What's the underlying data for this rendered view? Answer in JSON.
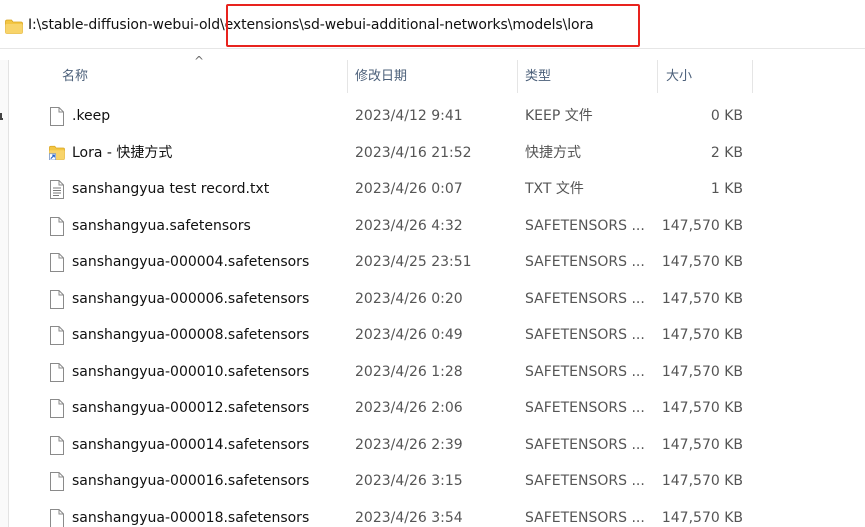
{
  "address_bar": {
    "path": "I:\\stable-diffusion-webui-old\\extensions\\sd-webui-additional-networks\\models\\lora",
    "folder_icon": "folder-icon"
  },
  "columns": {
    "name": "名称",
    "date": "修改日期",
    "type": "类型",
    "size": "大小"
  },
  "files": [
    {
      "name": ".keep",
      "date": "2023/4/12 9:41",
      "type": "KEEP 文件",
      "size": "0 KB",
      "icon": "blank-file-icon"
    },
    {
      "name": "Lora - 快捷方式",
      "date": "2023/4/16 21:52",
      "type": "快捷方式",
      "size": "2 KB",
      "icon": "folder-shortcut-icon"
    },
    {
      "name": "sanshangyua test record.txt",
      "date": "2023/4/26 0:07",
      "type": "TXT 文件",
      "size": "1 KB",
      "icon": "text-file-icon"
    },
    {
      "name": "sanshangyua.safetensors",
      "date": "2023/4/26 4:32",
      "type": "SAFETENSORS ...",
      "size": "147,570 KB",
      "icon": "blank-file-icon"
    },
    {
      "name": "sanshangyua-000004.safetensors",
      "date": "2023/4/25 23:51",
      "type": "SAFETENSORS ...",
      "size": "147,570 KB",
      "icon": "blank-file-icon"
    },
    {
      "name": "sanshangyua-000006.safetensors",
      "date": "2023/4/26 0:20",
      "type": "SAFETENSORS ...",
      "size": "147,570 KB",
      "icon": "blank-file-icon"
    },
    {
      "name": "sanshangyua-000008.safetensors",
      "date": "2023/4/26 0:49",
      "type": "SAFETENSORS ...",
      "size": "147,570 KB",
      "icon": "blank-file-icon"
    },
    {
      "name": "sanshangyua-000010.safetensors",
      "date": "2023/4/26 1:28",
      "type": "SAFETENSORS ...",
      "size": "147,570 KB",
      "icon": "blank-file-icon"
    },
    {
      "name": "sanshangyua-000012.safetensors",
      "date": "2023/4/26 2:06",
      "type": "SAFETENSORS ...",
      "size": "147,570 KB",
      "icon": "blank-file-icon"
    },
    {
      "name": "sanshangyua-000014.safetensors",
      "date": "2023/4/26 2:39",
      "type": "SAFETENSORS ...",
      "size": "147,570 KB",
      "icon": "blank-file-icon"
    },
    {
      "name": "sanshangyua-000016.safetensors",
      "date": "2023/4/26 3:15",
      "type": "SAFETENSORS ...",
      "size": "147,570 KB",
      "icon": "blank-file-icon"
    },
    {
      "name": "sanshangyua-000018.safetensors",
      "date": "2023/4/26 3:54",
      "type": "SAFETENSORS ...",
      "size": "147,570 KB",
      "icon": "blank-file-icon"
    }
  ],
  "colors": {
    "highlight_box": "#e8231e",
    "folder": "#f3c644",
    "header_text": "#4c607a"
  }
}
